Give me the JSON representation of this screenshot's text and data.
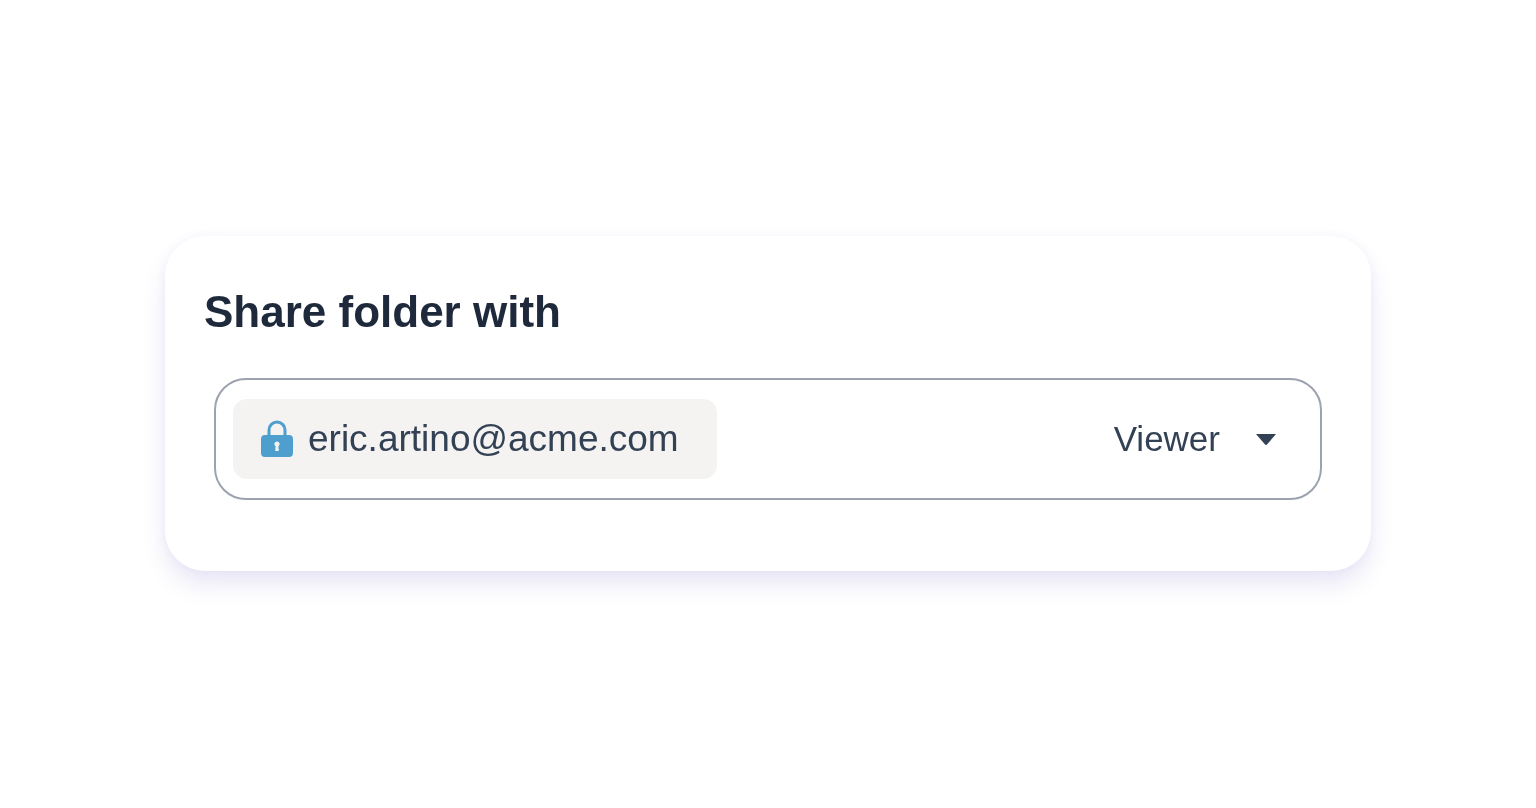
{
  "dialog": {
    "title": "Share folder with",
    "share_field": {
      "recipient": {
        "email": "eric.artino@acme.com"
      },
      "role": {
        "value": "Viewer"
      }
    }
  }
}
